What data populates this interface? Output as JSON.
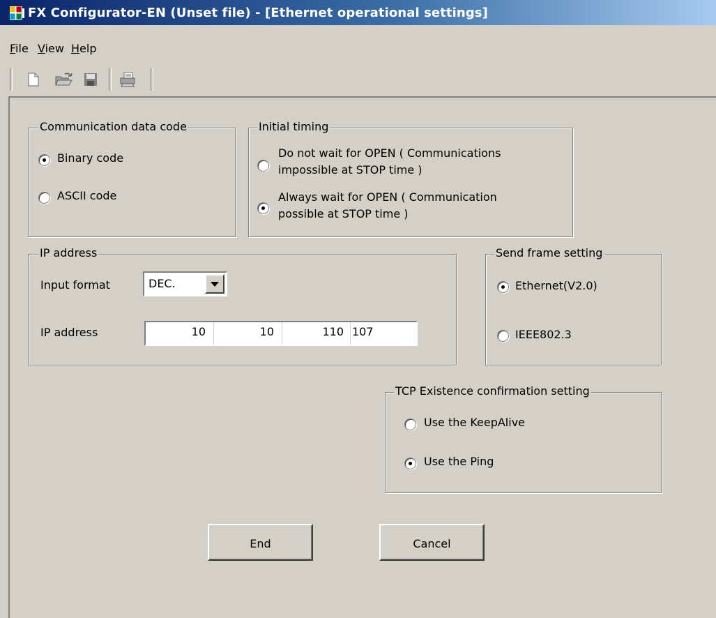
{
  "window": {
    "title": "FX Configurator-EN (Unset file) - [Ethernet operational settings]"
  },
  "menu": {
    "items": [
      {
        "label": "File",
        "mnemonic": "F"
      },
      {
        "label": "View",
        "mnemonic": "V"
      },
      {
        "label": "Help",
        "mnemonic": "H"
      }
    ]
  },
  "toolbar": {
    "buttons": [
      "new-file-icon",
      "open-folder-icon",
      "save-disk-icon",
      "print-icon"
    ]
  },
  "communication_data_code": {
    "legend": "Communication data code",
    "options": [
      {
        "label": "Binary code",
        "selected": true
      },
      {
        "label": "ASCII code",
        "selected": false
      }
    ]
  },
  "initial_timing": {
    "legend": "Initial timing",
    "options": [
      {
        "line1": "Do not wait for OPEN ( Communications",
        "line2": "impossible at STOP time )",
        "selected": false
      },
      {
        "line1": "Always wait for OPEN ( Communication",
        "line2": "possible at STOP time )",
        "selected": true
      }
    ]
  },
  "ip_address": {
    "legend": "IP address",
    "input_format_label": "Input format",
    "input_format_value": "DEC.",
    "ip_label": "IP address",
    "octets": [
      "10",
      "10",
      "110",
      "107"
    ]
  },
  "send_frame": {
    "legend": "Send frame setting",
    "options": [
      {
        "label": "Ethernet(V2.0)",
        "selected": true
      },
      {
        "label": "IEEE802.3",
        "selected": false
      }
    ]
  },
  "tcp_existence": {
    "legend": "TCP Existence confirmation setting",
    "options": [
      {
        "label": "Use the KeepAlive",
        "selected": false
      },
      {
        "label": "Use the Ping",
        "selected": true
      }
    ]
  },
  "buttons": {
    "end": "End",
    "cancel": "Cancel"
  }
}
